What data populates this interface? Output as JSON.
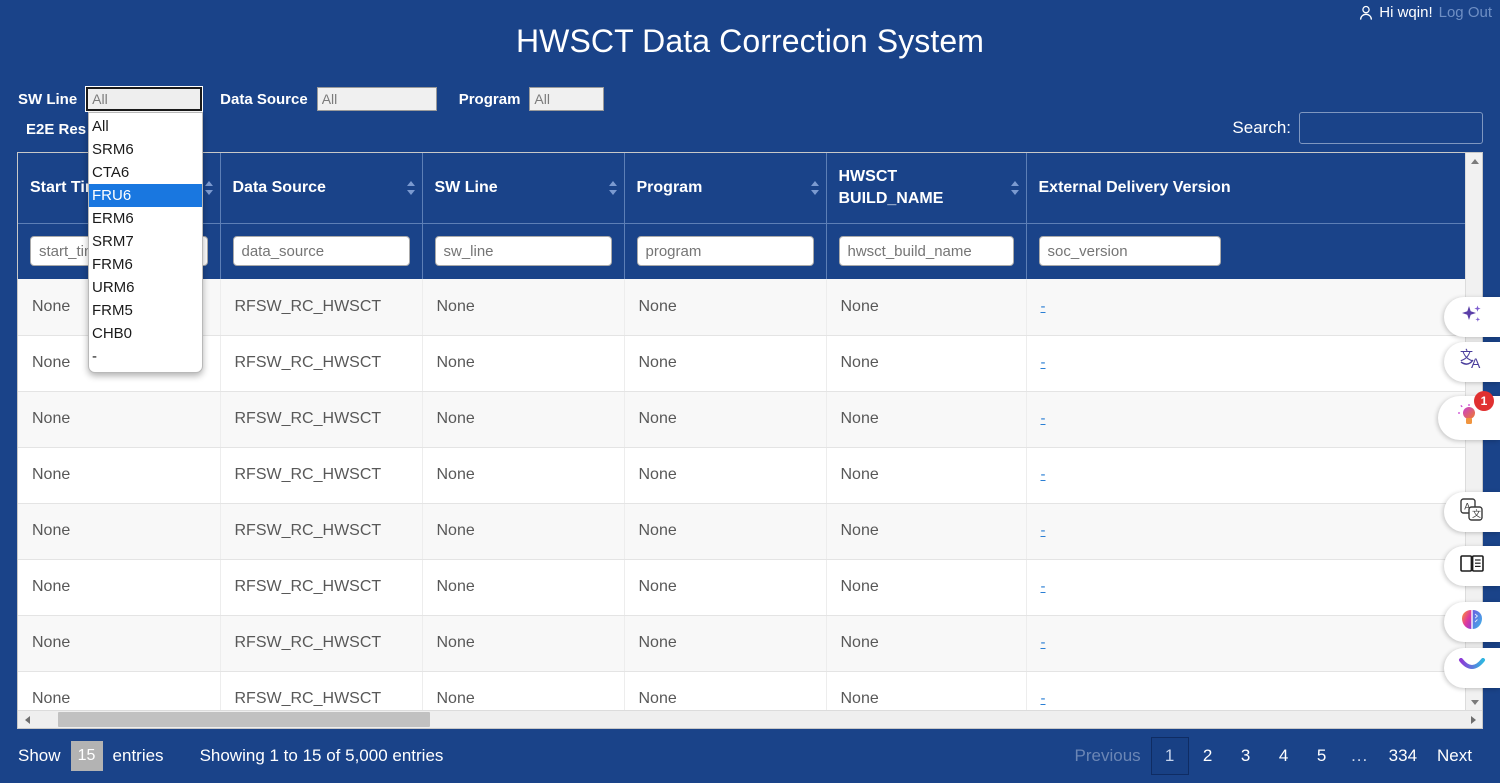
{
  "userbar": {
    "person_icon": "person-icon",
    "greeting": "Hi wqin!",
    "logout": "Log Out"
  },
  "title": "HWSCT Data Correction System",
  "filters": {
    "sw_line": {
      "label": "SW Line",
      "value": "All"
    },
    "data_source": {
      "label": "Data Source",
      "value": "All"
    },
    "program": {
      "label": "Program",
      "value": "All"
    },
    "e2e_result": {
      "label": "E2E Res",
      "value": ""
    },
    "sw_line_options": [
      "All",
      "SRM6",
      "CTA6",
      "FRU6",
      "ERM6",
      "SRM7",
      "FRM6",
      "URM6",
      "FRM5",
      "CHB0",
      "-"
    ],
    "sw_line_selected": "FRU6"
  },
  "search": {
    "label": "Search:",
    "value": ""
  },
  "table": {
    "columns": [
      {
        "title": "Start Time",
        "filter_placeholder": "start_time",
        "sortable": true
      },
      {
        "title": "Data Source",
        "filter_placeholder": "data_source",
        "sortable": true
      },
      {
        "title": "SW Line",
        "filter_placeholder": "sw_line",
        "sortable": true
      },
      {
        "title": "Program",
        "filter_placeholder": "program",
        "sortable": true
      },
      {
        "title": "HWSCT BUILD_NAME",
        "filter_placeholder": "hwsct_build_name",
        "sortable": true
      },
      {
        "title": "External Delivery Version",
        "filter_placeholder": "soc_version",
        "sortable": false
      }
    ],
    "rows": [
      {
        "start_time": "None",
        "data_source": "RFSW_RC_HWSCT",
        "sw_line": "None",
        "program": "None",
        "hwsct_build_name": "None",
        "external_delivery_version": "-"
      },
      {
        "start_time": "None",
        "data_source": "RFSW_RC_HWSCT",
        "sw_line": "None",
        "program": "None",
        "hwsct_build_name": "None",
        "external_delivery_version": "-"
      },
      {
        "start_time": "None",
        "data_source": "RFSW_RC_HWSCT",
        "sw_line": "None",
        "program": "None",
        "hwsct_build_name": "None",
        "external_delivery_version": "-"
      },
      {
        "start_time": "None",
        "data_source": "RFSW_RC_HWSCT",
        "sw_line": "None",
        "program": "None",
        "hwsct_build_name": "None",
        "external_delivery_version": "-"
      },
      {
        "start_time": "None",
        "data_source": "RFSW_RC_HWSCT",
        "sw_line": "None",
        "program": "None",
        "hwsct_build_name": "None",
        "external_delivery_version": "-"
      },
      {
        "start_time": "None",
        "data_source": "RFSW_RC_HWSCT",
        "sw_line": "None",
        "program": "None",
        "hwsct_build_name": "None",
        "external_delivery_version": "-"
      },
      {
        "start_time": "None",
        "data_source": "RFSW_RC_HWSCT",
        "sw_line": "None",
        "program": "None",
        "hwsct_build_name": "None",
        "external_delivery_version": "-"
      },
      {
        "start_time": "None",
        "data_source": "RFSW_RC_HWSCT",
        "sw_line": "None",
        "program": "None",
        "hwsct_build_name": "None",
        "external_delivery_version": "-"
      }
    ]
  },
  "footer": {
    "show_label": "Show",
    "length_value": "15",
    "entries_label": "entries",
    "showing_info": "Showing 1 to 15 of 5,000 entries",
    "pagination": {
      "previous": "Previous",
      "pages": [
        "1",
        "2",
        "3",
        "4",
        "5",
        "...",
        "334"
      ],
      "current": "1",
      "next": "Next"
    }
  },
  "floating_tools": [
    {
      "icon": "sparkle-icon",
      "badge": ""
    },
    {
      "icon": "translate-icon",
      "badge": ""
    },
    {
      "icon": "lightbulb-idea-icon",
      "badge": "1"
    },
    {
      "icon": "translate-page-icon",
      "badge": ""
    },
    {
      "icon": "dictionary-book-icon",
      "badge": ""
    },
    {
      "icon": "brain-ai-icon",
      "badge": ""
    },
    {
      "icon": "smile-arc-icon",
      "badge": ""
    }
  ],
  "colors": {
    "brand_navy": "#1a4389",
    "header_navy": "#1a4389",
    "dropdown_highlight": "#1977e0",
    "link_blue": "#2b7fd4",
    "badge_red": "#e03030"
  }
}
